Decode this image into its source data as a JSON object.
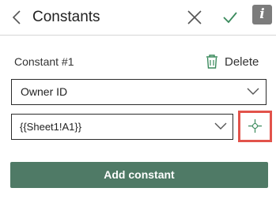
{
  "header": {
    "title": "Constants",
    "back_icon": "chevron-left-icon",
    "close_icon": "close-icon",
    "confirm_icon": "checkmark-icon",
    "info_label": "i"
  },
  "constant": {
    "label": "Constant #1",
    "delete_label": "Delete",
    "delete_icon": "trash-icon",
    "field_select": {
      "value": "Owner ID"
    },
    "value_select": {
      "value": "{{Sheet1!A1}}"
    },
    "picker_icon": "crosshair-icon"
  },
  "actions": {
    "add_label": "Add constant"
  },
  "colors": {
    "accent_button": "#4f7a66",
    "highlight_border": "#e2534b",
    "icon_green": "#3a8a5c",
    "info_bg": "#7c7c7c"
  }
}
